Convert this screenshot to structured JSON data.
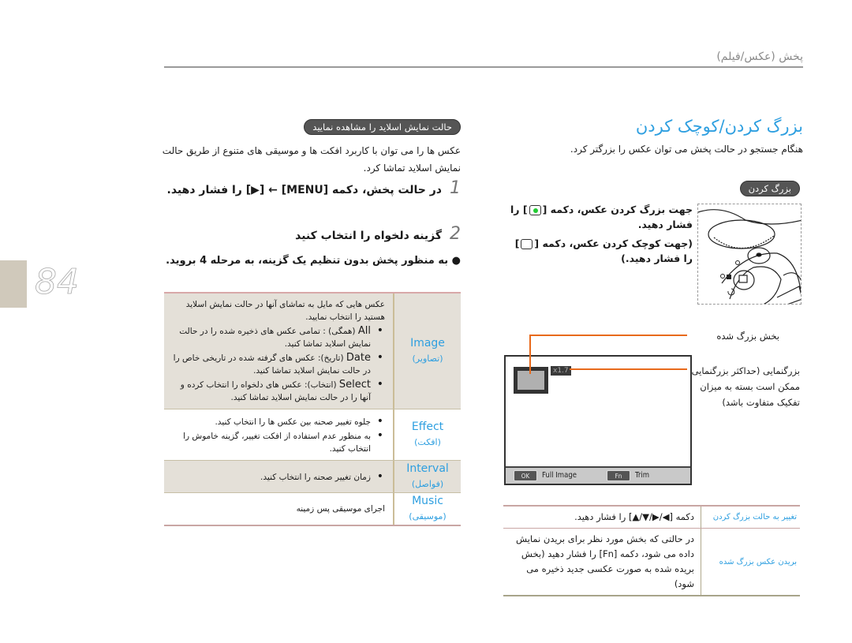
{
  "header": {
    "section_title": "پخش (عکس/فیلم)",
    "page_number": "84"
  },
  "zoom_section": {
    "heading": "بزرگ کردن/کوچک کردن",
    "intro": "هنگام جستجو در حالت پخش می توان عکس را بزرگتر کرد.",
    "pill": "بزرگ کردن",
    "instr_zoom_in_a": "جهت بزرگ کردن عکس، دکمه [",
    "instr_zoom_in_b": "] را فشار دهید.",
    "instr_zoom_out_a": "(جهت کوچک کردن عکس، دکمه [",
    "instr_zoom_out_b": "] را فشار دهید.)",
    "callout_enlarged": "بخش بزرگ شده",
    "callout_magnification": "بزرگنمایی (حداکثر بزرگنمایی ممکن است بسته به میزان تفکیک متفاوت باشد)",
    "lcd": {
      "zoom_level": "x1.7",
      "ok_key": "OK",
      "ok_label": "Full Image",
      "fn_key": "Fn",
      "fn_label": "Trim"
    },
    "table": [
      {
        "label": "تغییر به حالت بزرگ کردن",
        "value": "دکمه [◀/▶/▼/▲] را فشار دهید."
      },
      {
        "label": "بریدن عکس بزرگ شده",
        "value": "در حالتی که بخش مورد نظر برای بریدن نمایش داده می شود، دکمه [Fn] را فشار دهید (بخش بریده شده به صورت عکسی جدید ذخیره می شود)"
      }
    ]
  },
  "slideshow_section": {
    "pill": "حالت نمایش اسلاید را مشاهده نمایید",
    "intro": "عکس ها را می توان با کاربرد افکت ها و موسیقی های متنوع از طریق حالت نمایش اسلاید تماشا کرد.",
    "steps": [
      {
        "num": "1",
        "text": "در حالت پخش، دکمه [MENU] ← [▶] را فشار دهید."
      },
      {
        "num": "2",
        "text": "گزینه دلخواه را انتخاب کنید"
      }
    ],
    "step_note": "به منظور پخش بدون تنظیم یک گزینه، به مرحله 4 بروید.",
    "options": [
      {
        "label": "Image",
        "sub": "(تصاویر)",
        "intro": "عکس هایی که مایل به تماشای آنها در حالت نمایش اسلاید هستید را انتخاب نمایید.",
        "bullets": [
          {
            "key": "All",
            "text": "(همگی) : تمامی عکس های ذخیره شده را در حالت نمایش اسلاید تماشا کنید."
          },
          {
            "key": "Date",
            "text": "(تاریخ): عکس های گرفته شده در تاریخی خاص را در حالت نمایش اسلاید تماشا کنید."
          },
          {
            "key": "Select",
            "text": "(انتخاب): عکس های دلخواه را انتخاب کرده و آنها را در حالت نمایش اسلاید تماشا کنید."
          }
        ]
      },
      {
        "label": "Effect",
        "sub": "(افکت)",
        "bullets": [
          {
            "text": "جلوه تغییر صحنه بین عکس ها را انتخاب کنید."
          },
          {
            "text": "به منظور عدم استفاده از افکت تغییر، گزینه خاموش را انتخاب کنید."
          }
        ]
      },
      {
        "label": "Interval",
        "sub": "(فواصل)",
        "bullets": [
          {
            "text": "زمان تغییر صحنه را انتخاب کنید."
          }
        ]
      },
      {
        "label": "Music",
        "sub": "(موسیقی)",
        "plain": "اجرای موسیقی پس زمینه"
      }
    ]
  },
  "colors": {
    "accent_blue": "#2e9fe0",
    "leader_orange": "#e86a1c",
    "tab_beige": "#d0c9bb"
  }
}
